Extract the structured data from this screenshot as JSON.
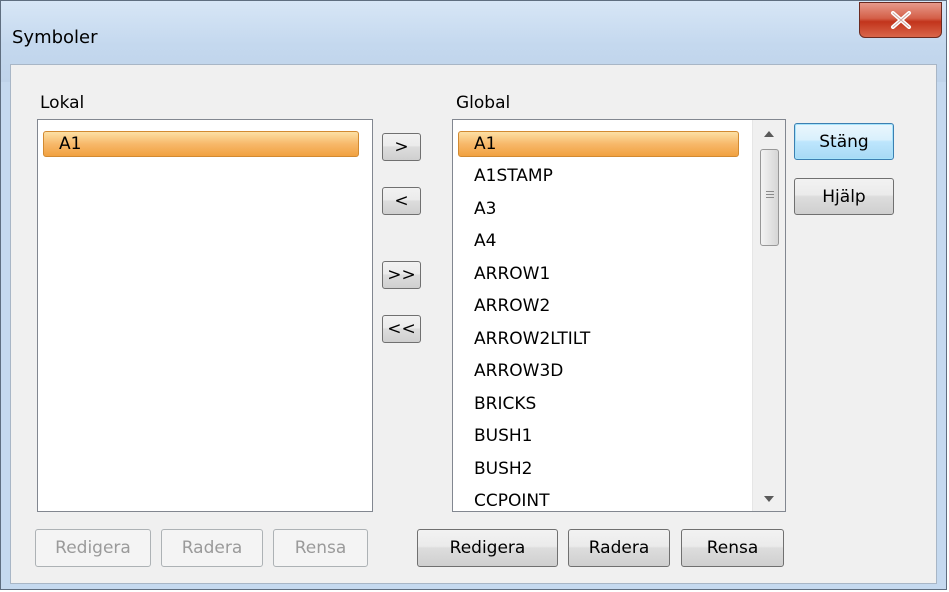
{
  "window": {
    "title": "Symboler",
    "close_glyph": "X"
  },
  "local": {
    "label": "Lokal",
    "items": [
      "A1"
    ],
    "selected_index": 0,
    "buttons": {
      "edit": "Redigera",
      "delete": "Radera",
      "clear": "Rensa"
    }
  },
  "global": {
    "label": "Global",
    "items": [
      "A1",
      "A1STAMP",
      "A3",
      "A4",
      "ARROW1",
      "ARROW2",
      "ARROW2LTILT",
      "ARROW3D",
      "BRICKS",
      "BUSH1",
      "BUSH2",
      "CCPOINT"
    ],
    "selected_index": 0,
    "buttons": {
      "edit": "Redigera",
      "delete": "Radera",
      "clear": "Rensa"
    }
  },
  "transfer": {
    "to_global": ">",
    "to_local": "<",
    "all_to_global": ">>",
    "all_to_local": "<<"
  },
  "actions": {
    "close": "Stäng",
    "help": "Hjälp"
  },
  "colors": {
    "selection": "#f7b86a",
    "default_button": "#bee6fd",
    "close_button": "#c2341c"
  }
}
